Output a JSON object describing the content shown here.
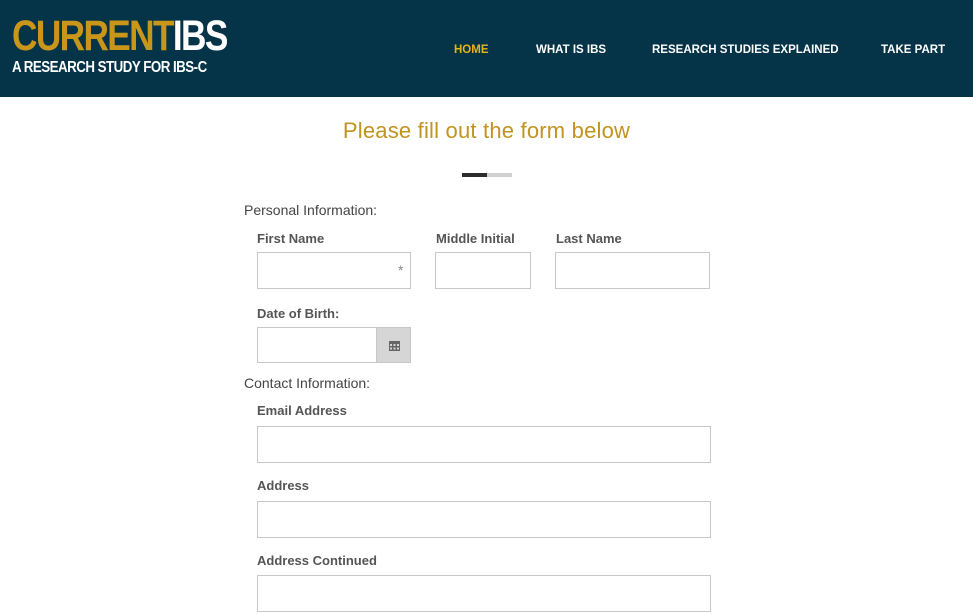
{
  "brand": {
    "logo_current": "CURRENT",
    "logo_ibs": "IBS",
    "tagline": "A RESEARCH STUDY FOR IBS-C"
  },
  "nav": {
    "items": [
      {
        "label": "HOME",
        "active": true
      },
      {
        "label": "WHAT IS IBS",
        "active": false
      },
      {
        "label": "RESEARCH STUDIES EXPLAINED",
        "active": false
      },
      {
        "label": "TAKE PART",
        "active": false
      }
    ]
  },
  "form": {
    "title": "Please fill out the form below",
    "progress": 0.5,
    "sections": {
      "personal": "Personal Information:",
      "contact": "Contact Information:"
    },
    "fields": {
      "first_name": {
        "label": "First Name",
        "value": "",
        "required_marker": "*"
      },
      "middle_initial": {
        "label": "Middle Initial",
        "value": ""
      },
      "last_name": {
        "label": "Last Name",
        "value": ""
      },
      "dob": {
        "label": "Date of Birth:",
        "value": ""
      },
      "email": {
        "label": "Email Address",
        "value": ""
      },
      "address": {
        "label": "Address",
        "value": ""
      },
      "address2": {
        "label": "Address Continued",
        "value": ""
      }
    }
  },
  "icons": {
    "calendar": "calendar-icon"
  },
  "colors": {
    "header_bg": "#053448",
    "accent_gold": "#c9961a",
    "nav_active": "#e8b21e",
    "title_gold": "#c1931f"
  }
}
